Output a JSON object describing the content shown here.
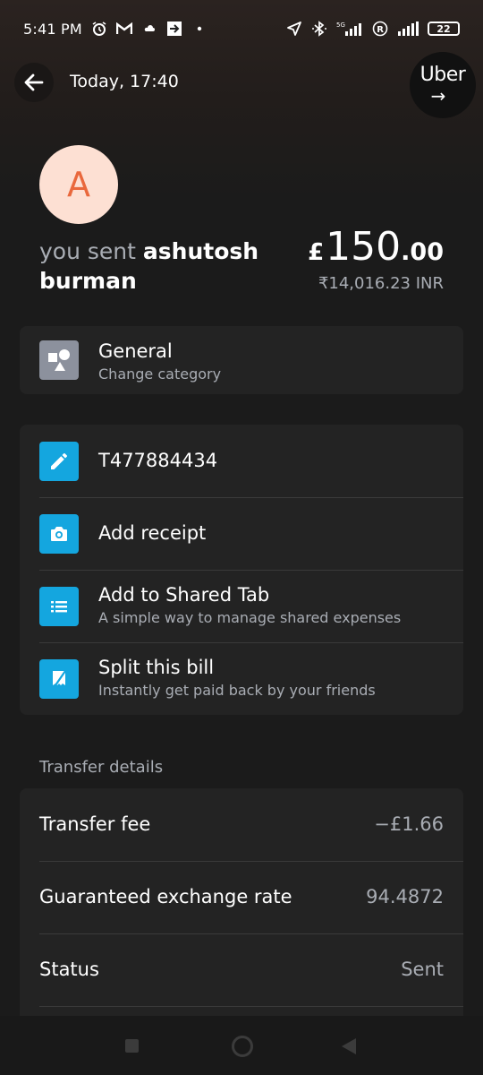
{
  "status_bar": {
    "time": "5:41 PM",
    "battery": "22",
    "network": "5G",
    "icons_left": [
      "alarm-icon",
      "gmail-icon",
      "cloud-icon",
      "exit-icon",
      "dot-icon"
    ],
    "icons_right": [
      "location-icon",
      "bluetooth-icon",
      "signal-icon",
      "roaming-icon",
      "signal-icon",
      "battery-icon"
    ]
  },
  "header": {
    "title": "Today, 17:40",
    "brand_badge": "Uber",
    "brand_arrow": "→"
  },
  "summary": {
    "avatar_letter": "A",
    "sent_prefix": "you sent",
    "recipient": "ashutosh burman",
    "amount_currency": "£",
    "amount_main": "150",
    "amount_decimal": ".00",
    "converted": "₹14,016.23 INR",
    "colors": {
      "avatar_bg": "#fde0d3",
      "avatar_fg": "#e9683c"
    }
  },
  "category": {
    "title": "General",
    "subtitle": "Change category"
  },
  "actions": [
    {
      "icon": "pencil-icon",
      "title": "T477884434",
      "subtitle": ""
    },
    {
      "icon": "camera-icon",
      "title": "Add receipt",
      "subtitle": ""
    },
    {
      "icon": "list-icon",
      "title": "Add to Shared Tab",
      "subtitle": "A simple way to manage shared expenses"
    },
    {
      "icon": "receipt-icon",
      "title": "Split this bill",
      "subtitle": "Instantly get paid back by your friends"
    }
  ],
  "transfer_details": {
    "heading": "Transfer details",
    "rows": [
      {
        "label": "Transfer fee",
        "value": "−£1.66"
      },
      {
        "label": "Guaranteed exchange rate",
        "value": "94.4872"
      },
      {
        "label": "Status",
        "value": "Sent"
      }
    ]
  },
  "colors": {
    "accent": "#14a6df",
    "category_tile": "#8c919d",
    "card": "#232323",
    "muted_text": "#a9adb4"
  }
}
